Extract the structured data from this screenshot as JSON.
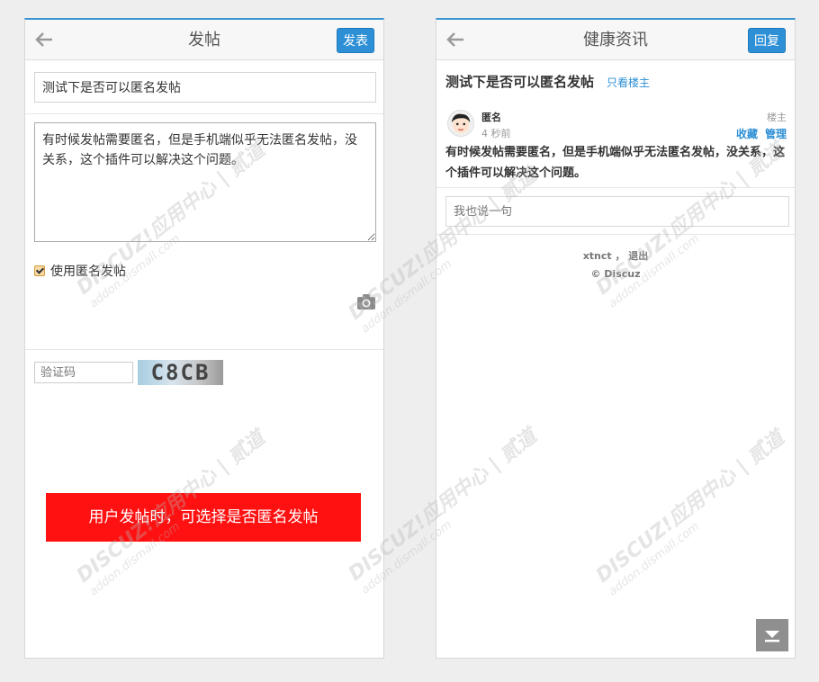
{
  "left": {
    "topbar": {
      "title": "发帖",
      "button": "发表"
    },
    "subject": "测试下是否可以匿名发帖",
    "body": "有时候发帖需要匿名，但是手机端似乎无法匿名发帖，没关系，这个插件可以解决这个问题。",
    "anonymous_label": "使用匿名发帖",
    "anonymous_checked": true,
    "captcha_placeholder": "验证码",
    "captcha_text": "C8CB",
    "banner": "用户发帖时，可选择是否匿名发帖"
  },
  "right": {
    "topbar": {
      "title": "健康资讯",
      "button": "回复"
    },
    "thread_title": "测试下是否可以匿名发帖",
    "only_op": "只看楼主",
    "author": "匿名",
    "time": "4 秒前",
    "floor": "楼主",
    "actions": [
      "收藏",
      "管理"
    ],
    "content": "有时候发帖需要匿名，但是手机端似乎无法匿名发帖，没关系，这个插件可以解决这个问题。",
    "reply_placeholder": "我也说一句",
    "footer_user": "xtnct ， 退出",
    "footer_copy": "© Discuz"
  },
  "watermark": {
    "main": "DISCUZ!应用中心 | 贰道",
    "sub": "addon.dismall.com"
  },
  "colors": {
    "accent": "#2d8fd5",
    "banner": "#ff1111"
  }
}
